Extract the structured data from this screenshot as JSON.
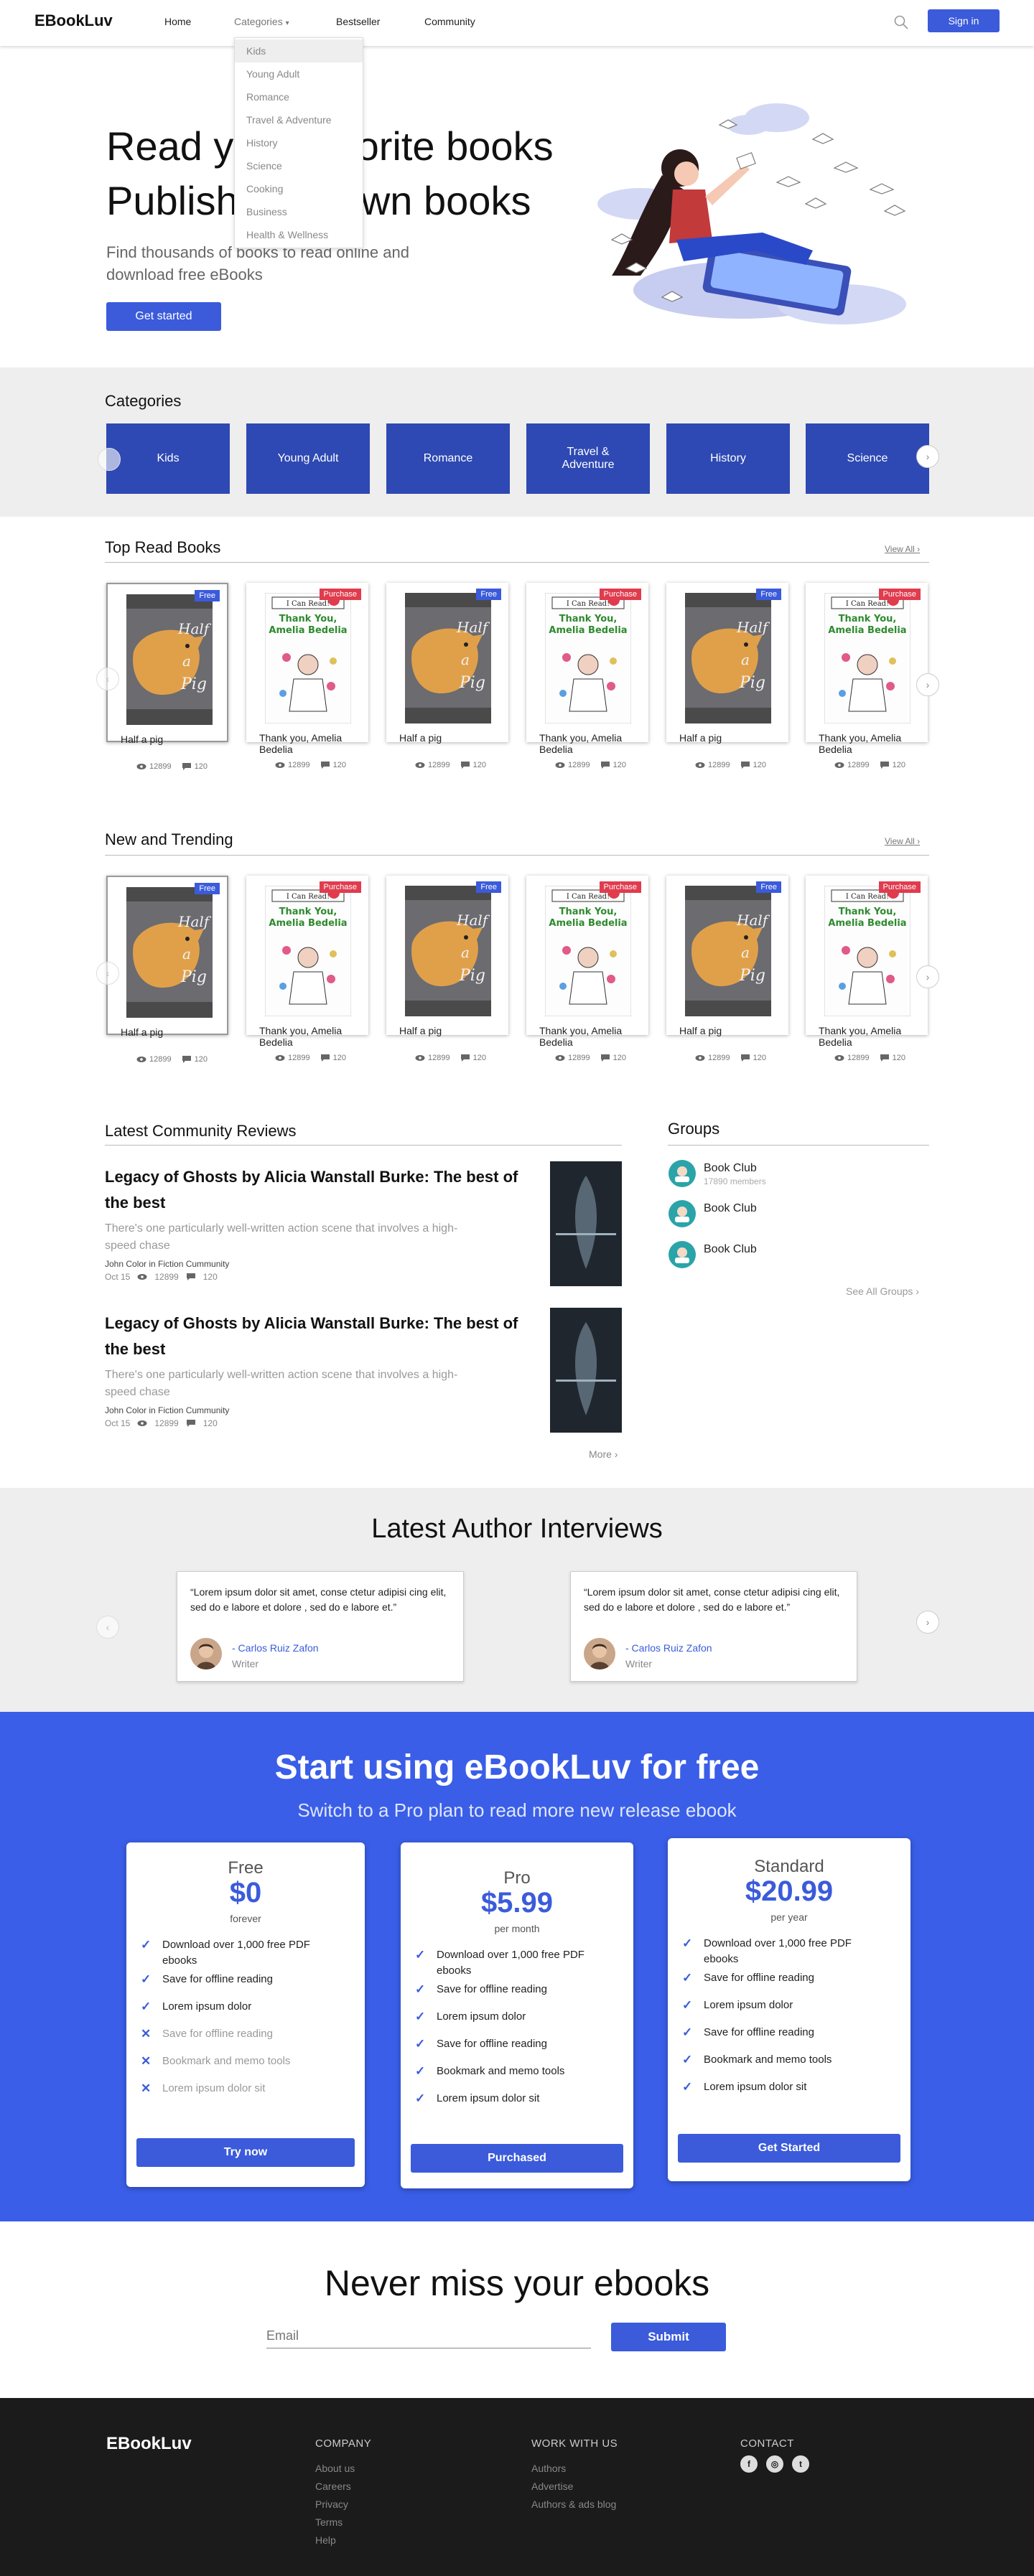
{
  "header": {
    "logo": "EBookLuv",
    "nav": [
      "Home",
      "Categories",
      "Bestseller",
      "Community"
    ],
    "signin_label": "Sign in",
    "accent_color": "#3b5bdb"
  },
  "dropdown": {
    "items": [
      "Kids",
      "Young Adult",
      "Romance",
      "Travel & Adventure",
      "History",
      "Science",
      "Cooking",
      "Business",
      "Health & Wellness"
    ],
    "active": "Kids"
  },
  "hero": {
    "line1": "Read your favorite books",
    "line2": "Publish your own books",
    "subtitle": "Find thousands of books to read online and download free eBooks",
    "cta": "Get started"
  },
  "categories": {
    "title": "Categories",
    "items": [
      "Kids",
      "Young Adult",
      "Romance",
      "Travel & Adventure",
      "History",
      "Science"
    ],
    "card_color": "#2e49b3"
  },
  "top_read": {
    "title": "Top Read Books",
    "view_all": "View All",
    "books": [
      {
        "title": "Half a pig",
        "badge": "Free",
        "views": "12899",
        "comments": "120"
      },
      {
        "title": "Thank you, Amelia Bedelia",
        "badge": "Purchase",
        "views": "12899",
        "comments": "120"
      },
      {
        "title": "Half a pig",
        "badge": "Free",
        "views": "12899",
        "comments": "120"
      },
      {
        "title": "Thank you, Amelia Bedelia",
        "badge": "Purchase",
        "views": "12899",
        "comments": "120"
      },
      {
        "title": "Half a pig",
        "badge": "Free",
        "views": "12899",
        "comments": "120"
      },
      {
        "title": "Thank you, Amelia Bedelia",
        "badge": "Purchase",
        "views": "12899",
        "comments": "120"
      }
    ]
  },
  "new_trending": {
    "title": "New and Trending",
    "view_all": "View All",
    "books": [
      {
        "title": "Half a pig",
        "badge": "Free",
        "views": "12899",
        "comments": "120"
      },
      {
        "title": "Thank you, Amelia Bedelia",
        "badge": "Purchase",
        "views": "12899",
        "comments": "120"
      },
      {
        "title": "Half a pig",
        "badge": "Free",
        "views": "12899",
        "comments": "120"
      },
      {
        "title": "Thank you, Amelia Bedelia",
        "badge": "Purchase",
        "views": "12899",
        "comments": "120"
      },
      {
        "title": "Half a pig",
        "badge": "Free",
        "views": "12899",
        "comments": "120"
      },
      {
        "title": "Thank you, Amelia Bedelia",
        "badge": "Purchase",
        "views": "12899",
        "comments": "120"
      }
    ]
  },
  "reviews": {
    "title": "Latest Community Reviews",
    "items": [
      {
        "title": "Legacy of Ghosts by Alicia Wanstall Burke: The best of the best",
        "snippet": "There's one particularly well-written action scene that involves a high-speed chase",
        "meta": "John Color in Fiction Cummunity",
        "date": "Oct 15",
        "views": "12899",
        "comments": "120"
      },
      {
        "title": "Legacy of Ghosts by Alicia Wanstall Burke: The best of the best",
        "snippet": "There's one particularly well-written action scene that involves a high-speed chase",
        "meta": "John Color in Fiction Cummunity",
        "date": "Oct 15",
        "views": "12899",
        "comments": "120"
      }
    ],
    "more": "More"
  },
  "groups": {
    "title": "Groups",
    "items": [
      {
        "name": "Book Club",
        "members": "17890 members"
      },
      {
        "name": "Book Club",
        "members": ""
      },
      {
        "name": "Book Club",
        "members": ""
      }
    ],
    "see_all": "See All Groups"
  },
  "interviews": {
    "title": "Latest Author Interviews",
    "items": [
      {
        "quote": "“Lorem ipsum dolor sit amet, conse ctetur adipisi cing elit, sed do e labore et dolore , sed do e labore et.”",
        "name": "- Carlos Ruiz Zafon",
        "role": "Writer"
      },
      {
        "quote": "“Lorem ipsum dolor sit amet, conse ctetur adipisi cing elit, sed do e labore et dolore , sed do e labore et.”",
        "name": "- Carlos Ruiz Zafon",
        "role": "Writer"
      }
    ]
  },
  "pricing": {
    "title": "Start using eBookLuv for free",
    "subtitle": "Switch to a Pro plan to read more new release ebook",
    "bg_color": "#3a5ee8",
    "plans": [
      {
        "name": "Free",
        "price": "$0",
        "per": "forever",
        "button": "Try now",
        "features": [
          {
            "text": "Download over 1,000 free PDF ebooks",
            "included": true
          },
          {
            "text": "Save for offline reading",
            "included": true
          },
          {
            "text": "Lorem ipsum dolor",
            "included": true
          },
          {
            "text": "Save for offline reading",
            "included": false
          },
          {
            "text": "Bookmark and memo tools",
            "included": false
          },
          {
            "text": "Lorem ipsum dolor sit",
            "included": false
          }
        ]
      },
      {
        "name": "Pro",
        "price": "$5.99",
        "per": "per month",
        "button": "Purchased",
        "features": [
          {
            "text": "Download over 1,000 free PDF ebooks",
            "included": true
          },
          {
            "text": "Save for offline reading",
            "included": true
          },
          {
            "text": "Lorem ipsum dolor",
            "included": true
          },
          {
            "text": "Save for offline reading",
            "included": true
          },
          {
            "text": "Bookmark and memo tools",
            "included": true
          },
          {
            "text": "Lorem ipsum dolor sit",
            "included": true
          }
        ]
      },
      {
        "name": "Standard",
        "price": "$20.99",
        "per": "per year",
        "button": "Get Started",
        "features": [
          {
            "text": "Download over 1,000 free PDF ebooks",
            "included": true
          },
          {
            "text": "Save for offline reading",
            "included": true
          },
          {
            "text": "Lorem ipsum dolor",
            "included": true
          },
          {
            "text": "Save for offline reading",
            "included": true
          },
          {
            "text": "Bookmark and memo tools",
            "included": true
          },
          {
            "text": "Lorem ipsum dolor sit",
            "included": true
          }
        ]
      }
    ]
  },
  "newsletter": {
    "title": "Never miss your ebooks",
    "placeholder": "Email",
    "button": "Submit"
  },
  "footer": {
    "logo": "EBookLuv",
    "company": {
      "title": "COMPANY",
      "links": [
        "About us",
        "Careers",
        "Privacy",
        "Terms",
        "Help"
      ]
    },
    "work": {
      "title": "WORK WITH US",
      "links": [
        "Authors",
        "Advertise",
        "Authors & ads blog"
      ]
    },
    "contact": {
      "title": "CONTACT",
      "social": [
        "facebook-icon",
        "instagram-icon",
        "twitter-icon"
      ]
    }
  }
}
